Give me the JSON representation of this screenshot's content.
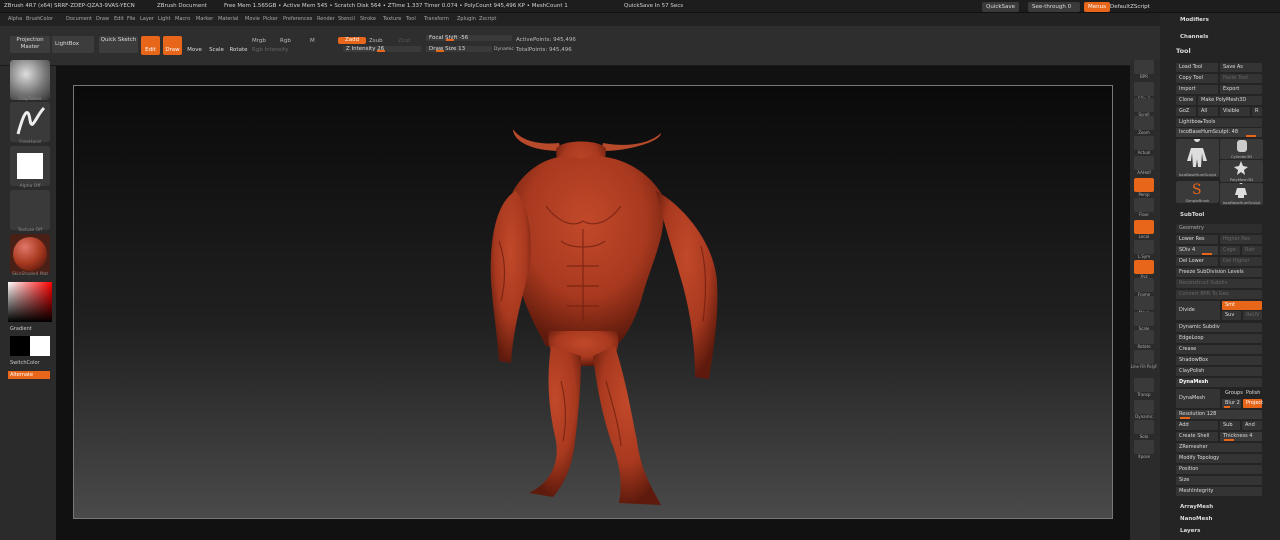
{
  "title_bar": {
    "app": "ZBrush 4R7 (x64)",
    "serial": "SRRF-ZDEP-QZA3-9VAS-YECN",
    "document": "ZBrush Document",
    "mem_status": "Free Mem 1.565GB • Active Mem 545 • Scratch Disk 564 • ZTime 1.337 Timer 0.074 • PolyCount 945,496 KP • MeshCount 1",
    "quicksave_msg": "QuickSave In 57 Secs",
    "quicksave_button": "QuickSave",
    "seethrough": "See-through  0",
    "menus_button": "Menus",
    "default_script": "DefaultZScript"
  },
  "menubar": [
    "Alpha",
    "Brush",
    "Color",
    "Document",
    "Draw",
    "Edit",
    "File",
    "Layer",
    "Light",
    "Macro",
    "Marker",
    "Material",
    "Movie",
    "Picker",
    "Preferences",
    "Render",
    "Stencil",
    "Stroke",
    "Texture",
    "Tool",
    "Transform",
    "Zplugin",
    "Zscript"
  ],
  "toolbar": {
    "projection_master": "Projection Master",
    "lightbox": "LightBox",
    "quick_sketch": "Quick Sketch",
    "edit": "Edit",
    "draw": "Draw",
    "move": "Move",
    "scale": "Scale",
    "rotate": "Rotate",
    "mrgb": "Mrgb",
    "rgb": "Rgb",
    "m": "M",
    "rgb_intensity": "Rgb Intensity",
    "zadd": "Zadd",
    "zsub": "Zsub",
    "zcut": "Zcut",
    "z_intensity": "Z Intensity 26",
    "focal_shift": "Focal Shift -56",
    "draw_size": "Draw Size 13",
    "dynamic": "Dynamic",
    "active_points": "ActivePoints: 945,496",
    "total_points": "TotalPoints: 945,496"
  },
  "left_shelf": {
    "brush_label": "ClayTubes",
    "stroke_label": "FreeHand",
    "alpha_label": "Alpha Off",
    "texture_label": "Texture Off",
    "material_label": "SkinShade4 Mat",
    "gradient": "Gradient",
    "switch_color": "SwitchColor",
    "alternate": "Alternate"
  },
  "right_shelf": [
    "BPR",
    "SPix 3",
    "Scroll",
    "Zoom",
    "Actual",
    "AAHalf",
    "Persp",
    "Floor",
    "Local",
    "L.Sym",
    "Xyz",
    "Frame",
    "Move",
    "Scale",
    "Rotate",
    "Line Fill PolyF",
    "Transp",
    "Dynamic",
    "Solo",
    "Xpose"
  ],
  "tray": {
    "modifiers": "Modifiers",
    "channels": "Channels",
    "tool": "Tool",
    "load_tool": "Load Tool",
    "save_as": "Save As",
    "copy_tool": "Copy Tool",
    "paste_tool": "Paste Tool",
    "import": "Import",
    "export": "Export",
    "clone": "Clone",
    "make_polymesh": "Make PolyMesh3D",
    "goz": "GoZ",
    "all": "All",
    "visible": "Visible",
    "r": "R",
    "lightbox_tools": "Lightbox▸Tools",
    "current_tool": "IscoBaseHumSculpt. 48",
    "thumbs": [
      "IscoBaseHumSculpt",
      "Cylinder3D",
      "PolyMesh3D",
      "SimpleBrush",
      "IscoBaseHumSculpt"
    ],
    "subtool": "SubTool",
    "geometry": "Geometry",
    "lower_res": "Lower Res",
    "higher_res": "Higher Res",
    "sdiv": "SDiv 4",
    "cage": "Cage",
    "rstr": "Rstr",
    "del_lower": "Del Lower",
    "del_higher": "Del Higher",
    "freeze_subdiv": "Freeze SubDivision Levels",
    "reconstruct": "Reconstruct Subdiv",
    "convert_bpr": "Convert BPR To Geo",
    "divide": "Divide",
    "smt": "Smt",
    "suv": "Suv",
    "reuv": "ReUV",
    "dynamic_subdiv": "Dynamic Subdiv",
    "edgeloop": "EdgeLoop",
    "crease": "Crease",
    "shadowbox": "ShadowBox",
    "claypolish": "ClayPolish",
    "dynamesh_head": "DynaMesh",
    "dynamesh": "DynaMesh",
    "groups": "Groups",
    "polish": "Polish",
    "blur": "Blur 2",
    "project": "Project",
    "resolution": "Resolution 128",
    "add": "Add",
    "sub": "Sub",
    "and": "And",
    "create_shell": "Create Shell",
    "thickness": "Thickness 4",
    "zremesher": "ZRemesher",
    "modify_topology": "Modify Topology",
    "position": "Position",
    "size": "Size",
    "meshintegrity": "MeshIntegrity",
    "arraymesh": "ArrayMesh",
    "nanomesh": "NanoMesh",
    "layers": "Layers"
  },
  "colors": {
    "accent": "#e8661a",
    "model": "#a8391f"
  }
}
